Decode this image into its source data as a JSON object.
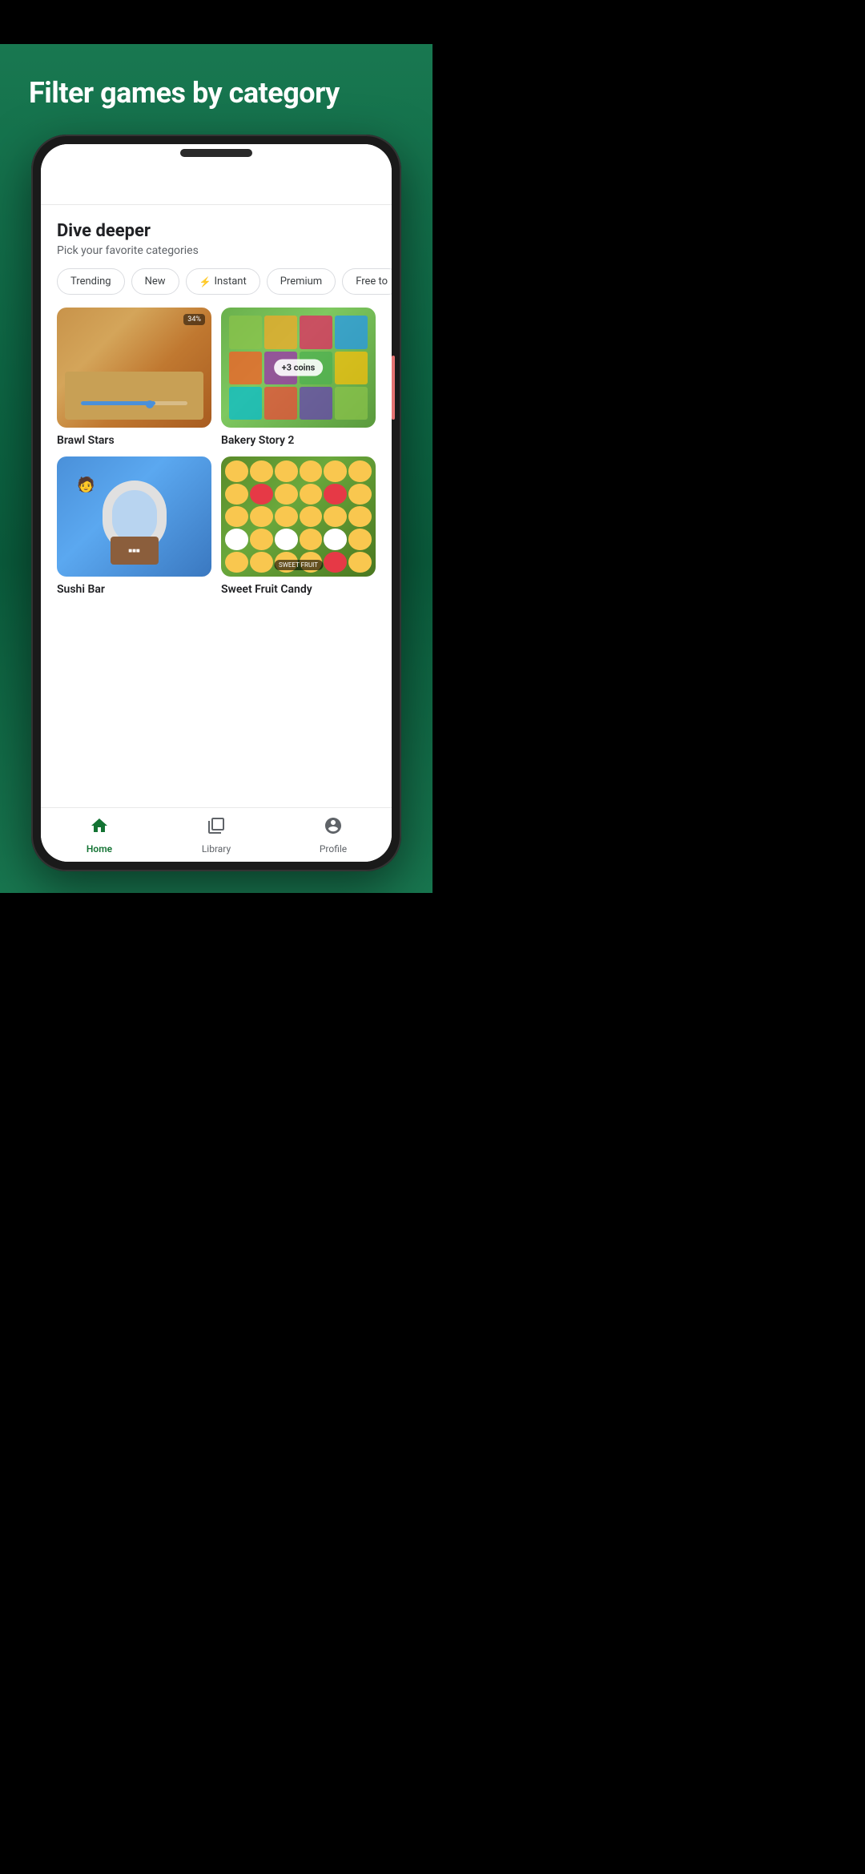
{
  "hero": {
    "title": "Filter games by category"
  },
  "phone": {
    "section": {
      "title": "Dive deeper",
      "subtitle": "Pick your favorite categories"
    },
    "chips": [
      {
        "label": "Trending",
        "icon": null
      },
      {
        "label": "New",
        "icon": null
      },
      {
        "label": "Instant",
        "icon": "⚡"
      },
      {
        "label": "Premium",
        "icon": null
      },
      {
        "label": "Free to",
        "icon": null
      }
    ],
    "games": [
      {
        "name": "Brawl Stars",
        "type": "brawl"
      },
      {
        "name": "Bakery Story 2",
        "type": "bakery",
        "badge": "+3 coins"
      },
      {
        "name": "Sushi Bar",
        "type": "sushi"
      },
      {
        "name": "Sweet Fruit Candy",
        "type": "sweet"
      }
    ],
    "nav": {
      "items": [
        {
          "label": "Home",
          "icon": "🏠",
          "active": true
        },
        {
          "label": "Library",
          "icon": "📋",
          "active": false
        },
        {
          "label": "Profile",
          "icon": "👤",
          "active": false
        }
      ]
    }
  }
}
